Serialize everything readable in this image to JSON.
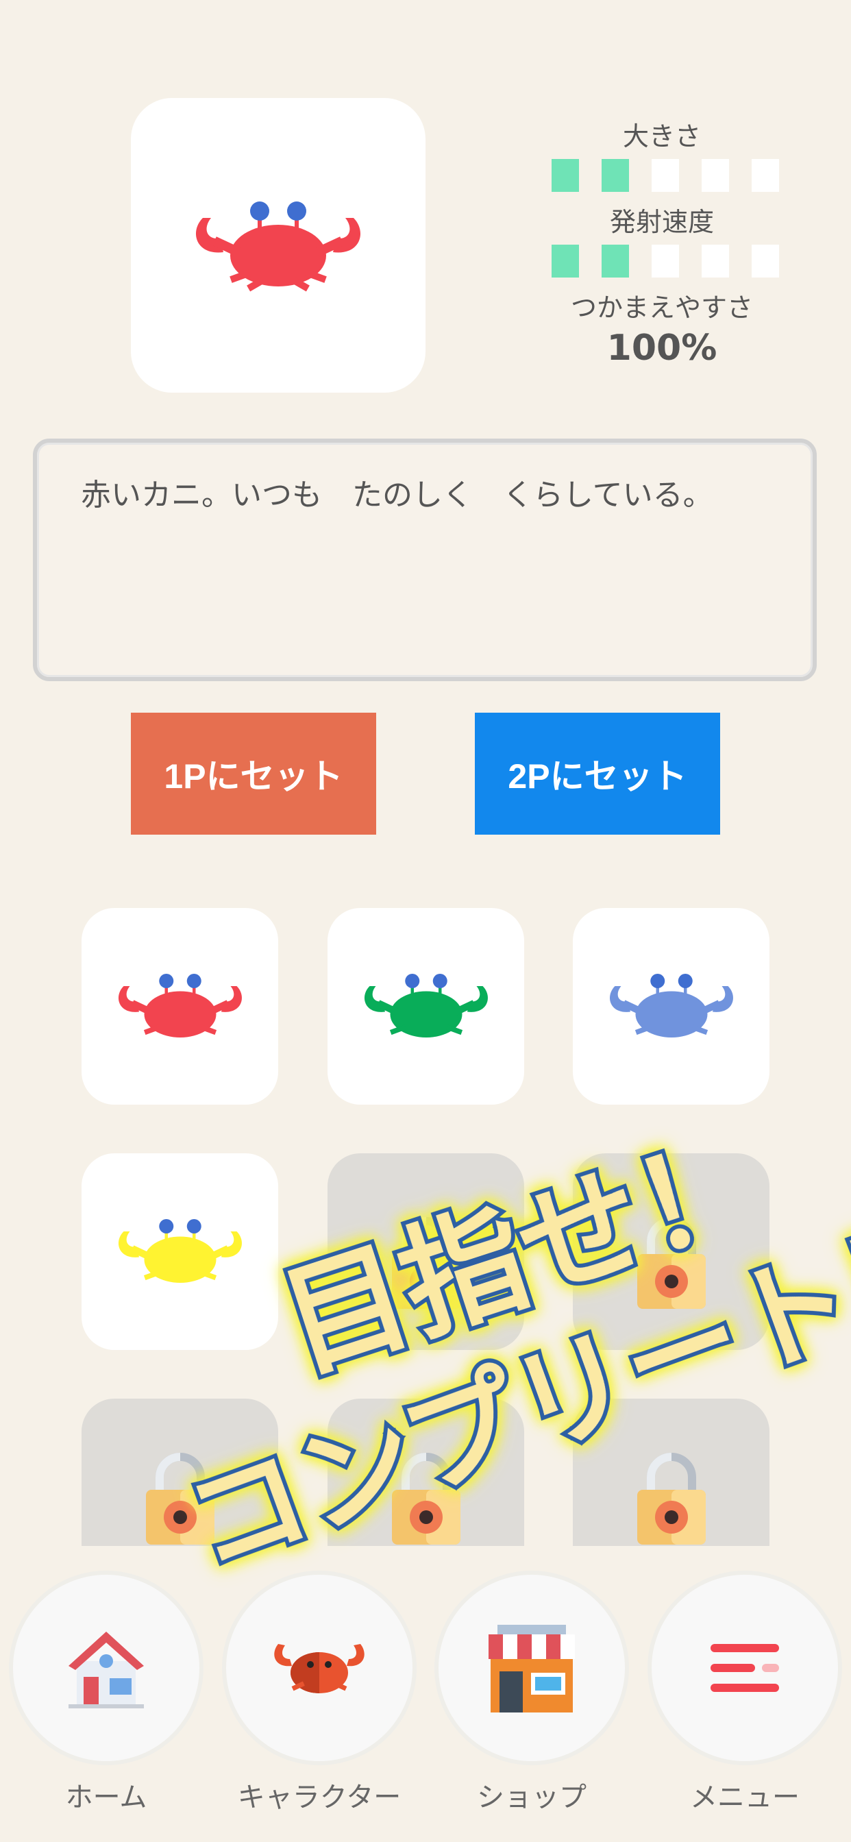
{
  "stats": {
    "size_label": "大きさ",
    "size_level": 2,
    "size_max": 5,
    "speed_label": "発射速度",
    "speed_level": 2,
    "speed_max": 5,
    "catch_label": "つかまえやすさ",
    "catch_value": "100%"
  },
  "description": "赤いカニ。いつも　たのしく　くらしている。",
  "buttons": {
    "set_1p": "1Pにセット",
    "set_2p": "2Pにセット"
  },
  "banner": {
    "line1": "目指せ！",
    "line2": "コンプリート！！"
  },
  "characters": [
    {
      "name": "red-crab",
      "color": "#f2444f",
      "locked": false
    },
    {
      "name": "green-crab",
      "color": "#09ad59",
      "locked": false
    },
    {
      "name": "blue-crab",
      "color": "#7093dd",
      "locked": false
    },
    {
      "name": "yellow-crab",
      "color": "#fff331",
      "locked": false
    },
    {
      "name": "locked",
      "locked": true
    },
    {
      "name": "locked",
      "locked": true
    },
    {
      "name": "locked",
      "locked": true
    },
    {
      "name": "locked",
      "locked": true
    },
    {
      "name": "locked",
      "locked": true
    }
  ],
  "nav": {
    "home": "ホーム",
    "character": "キャラクター",
    "shop": "ショップ",
    "menu": "メニュー"
  },
  "colors": {
    "background": "#f6f1e8",
    "bar_on": "#6fe3b6",
    "button_1p": "#e66f50",
    "button_2p": "#1288ed",
    "crab_eye": "#3f6ed0"
  }
}
